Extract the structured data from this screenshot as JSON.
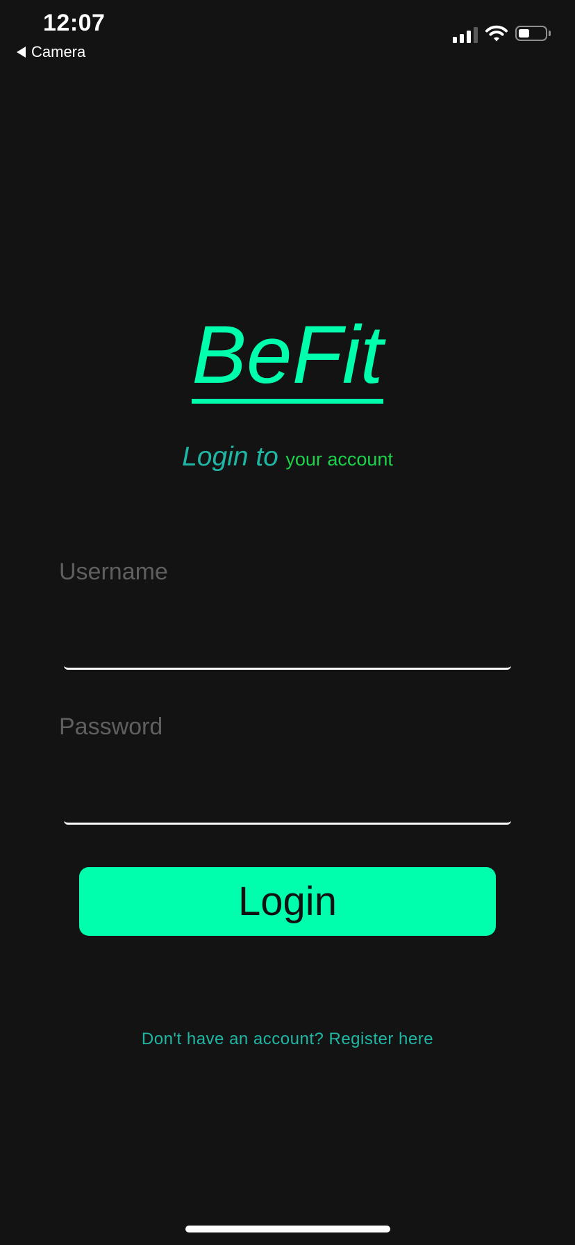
{
  "status_bar": {
    "time": "12:07",
    "back_label": "Camera"
  },
  "brand": {
    "logo_text": "BeFit",
    "tagline_strong": "Login to",
    "tagline_light": "your account",
    "accent_color": "#00ffad"
  },
  "form": {
    "username_label": "Username",
    "username_value": "",
    "password_label": "Password",
    "password_value": "",
    "login_button_label": "Login"
  },
  "footer": {
    "register_link": "Don't have an account? Register here"
  }
}
